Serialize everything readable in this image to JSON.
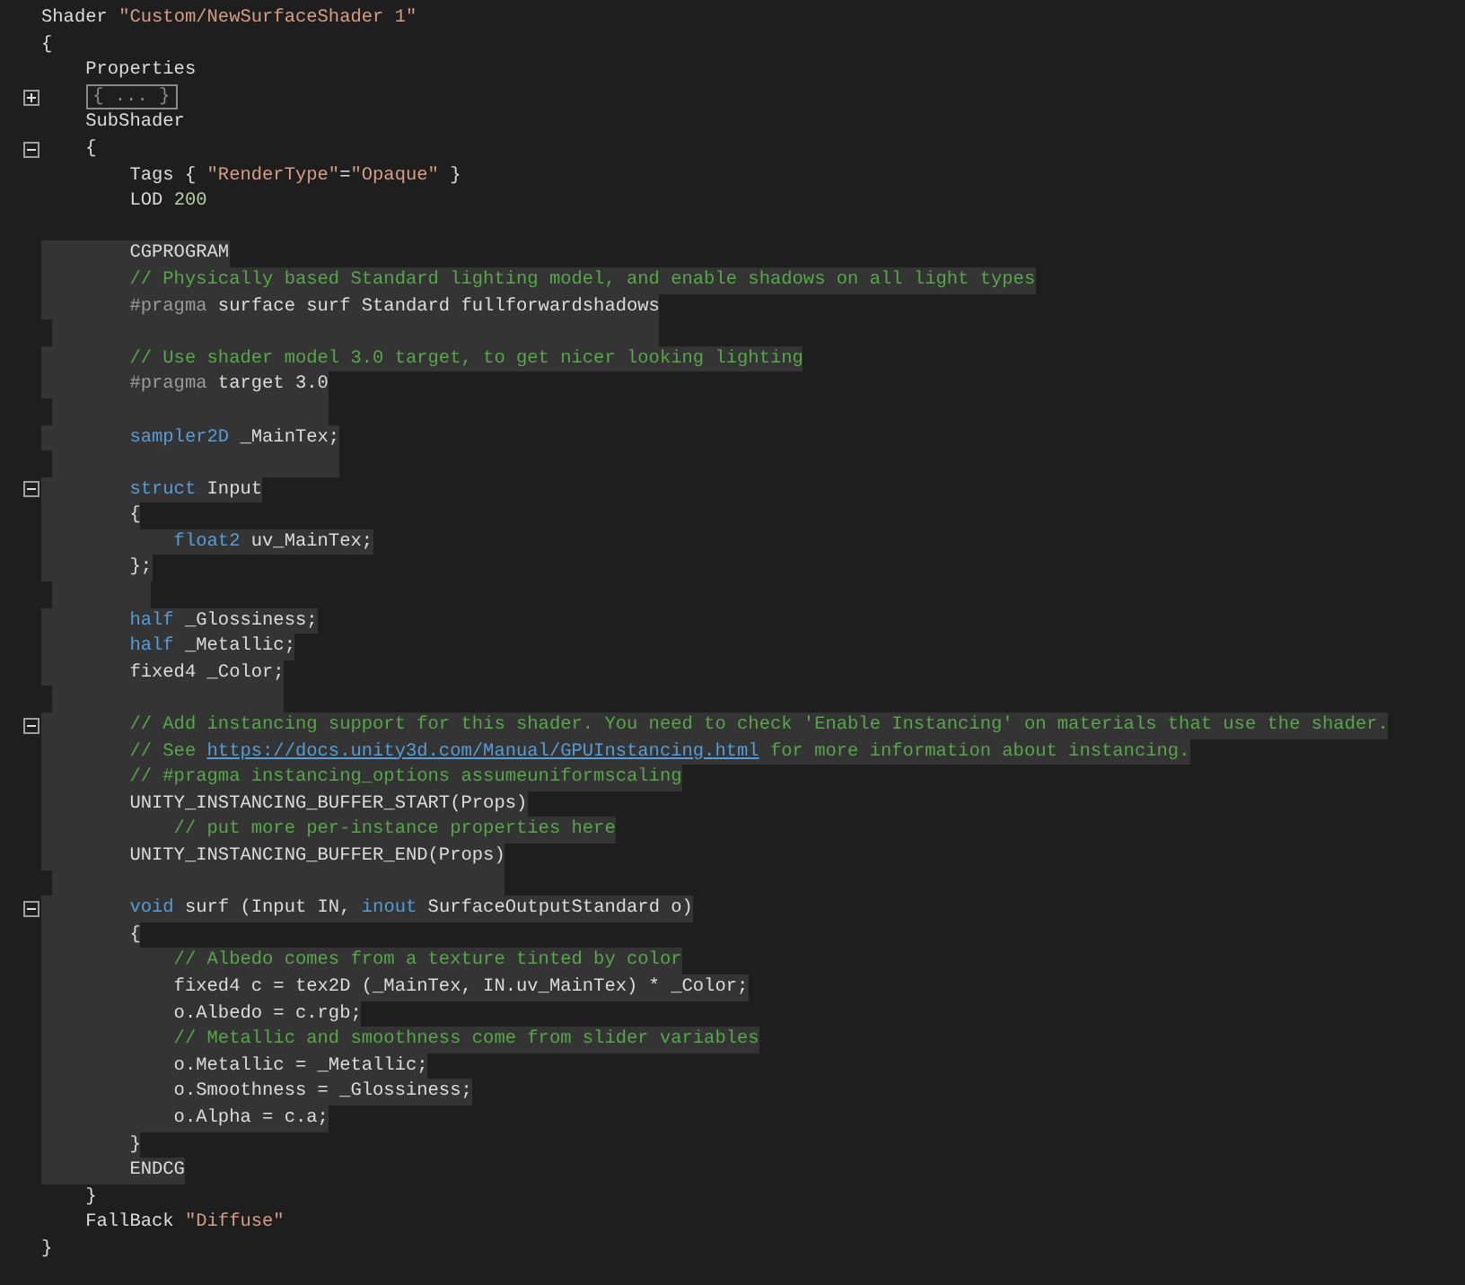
{
  "editor": {
    "lines": [
      {
        "selected": false,
        "tokens": [
          {
            "kind": "plain",
            "text": "Shader "
          },
          {
            "kind": "string",
            "text": "\"Custom/NewSurfaceShader 1\""
          }
        ]
      },
      {
        "selected": false,
        "tokens": [
          {
            "kind": "plain",
            "text": "{"
          }
        ]
      },
      {
        "selected": false,
        "tokens": [
          {
            "kind": "plain",
            "text": "    Properties"
          }
        ]
      },
      {
        "selected": false,
        "fold_expanded": false,
        "tokens": [
          {
            "kind": "collapsed",
            "text": "{ ... }"
          }
        ]
      },
      {
        "selected": false,
        "tokens": [
          {
            "kind": "plain",
            "text": "    SubShader"
          }
        ]
      },
      {
        "selected": false,
        "fold_expanded": true,
        "tokens": [
          {
            "kind": "plain",
            "text": "    {"
          }
        ]
      },
      {
        "selected": false,
        "tokens": [
          {
            "kind": "plain",
            "text": "        Tags { "
          },
          {
            "kind": "string",
            "text": "\"RenderType\""
          },
          {
            "kind": "plain",
            "text": "="
          },
          {
            "kind": "string",
            "text": "\"Opaque\""
          },
          {
            "kind": "plain",
            "text": " }"
          }
        ]
      },
      {
        "selected": false,
        "tokens": [
          {
            "kind": "plain",
            "text": "        LOD "
          },
          {
            "kind": "number",
            "text": "200"
          }
        ]
      },
      {
        "selected": false
      },
      {
        "selected": true,
        "tokens": [
          {
            "kind": "plain",
            "text": "        CGPROGRAM"
          }
        ]
      },
      {
        "selected": true,
        "tokens": [
          {
            "kind": "comment",
            "text": "        // Physically based Standard lighting model, and enable shadows on all light types"
          }
        ]
      },
      {
        "selected": true,
        "tokens": [
          {
            "kind": "directive",
            "text": "        #pragma"
          },
          {
            "kind": "plain",
            "text": " surface surf Standard fullforwardshadows"
          }
        ]
      },
      {
        "selected": true
      },
      {
        "selected": true,
        "tokens": [
          {
            "kind": "comment",
            "text": "        // Use shader model 3.0 target, to get nicer looking lighting"
          }
        ]
      },
      {
        "selected": true,
        "tokens": [
          {
            "kind": "directive",
            "text": "        #pragma"
          },
          {
            "kind": "plain",
            "text": " target 3.0"
          }
        ]
      },
      {
        "selected": true
      },
      {
        "selected": true,
        "tokens": [
          {
            "kind": "keyword",
            "text": "        sampler2D"
          },
          {
            "kind": "plain",
            "text": " _MainTex;"
          }
        ]
      },
      {
        "selected": true
      },
      {
        "selected": true,
        "fold_expanded": true,
        "tokens": [
          {
            "kind": "keyword",
            "text": "        struct"
          },
          {
            "kind": "plain",
            "text": " Input"
          }
        ]
      },
      {
        "selected": true,
        "tokens": [
          {
            "kind": "plain",
            "text": "        {"
          }
        ]
      },
      {
        "selected": true,
        "tokens": [
          {
            "kind": "keyword",
            "text": "            float2"
          },
          {
            "kind": "plain",
            "text": " uv_MainTex;"
          }
        ]
      },
      {
        "selected": true,
        "tokens": [
          {
            "kind": "plain",
            "text": "        };"
          }
        ]
      },
      {
        "selected": true
      },
      {
        "selected": true,
        "tokens": [
          {
            "kind": "keyword",
            "text": "        half"
          },
          {
            "kind": "plain",
            "text": " _Glossiness;"
          }
        ]
      },
      {
        "selected": true,
        "tokens": [
          {
            "kind": "keyword",
            "text": "        half"
          },
          {
            "kind": "plain",
            "text": " _Metallic;"
          }
        ]
      },
      {
        "selected": true,
        "tokens": [
          {
            "kind": "plain",
            "text": "        fixed4 _Color;"
          }
        ]
      },
      {
        "selected": true
      },
      {
        "selected": true,
        "fold_expanded": true,
        "tokens": [
          {
            "kind": "comment",
            "text": "        // Add instancing support for this shader. You need to check 'Enable Instancing' on materials that use the shader."
          }
        ]
      },
      {
        "selected": true,
        "tokens": [
          {
            "kind": "comment",
            "text": "        // See "
          },
          {
            "kind": "link",
            "text": "https://docs.unity3d.com/Manual/GPUInstancing.html"
          },
          {
            "kind": "comment",
            "text": " for more information about instancing."
          }
        ]
      },
      {
        "selected": true,
        "tokens": [
          {
            "kind": "comment",
            "text": "        // #pragma instancing_options assumeuniformscaling"
          }
        ]
      },
      {
        "selected": true,
        "tokens": [
          {
            "kind": "plain",
            "text": "        UNITY_INSTANCING_BUFFER_START(Props)"
          }
        ]
      },
      {
        "selected": true,
        "tokens": [
          {
            "kind": "comment",
            "text": "            // put more per-instance properties here"
          }
        ]
      },
      {
        "selected": true,
        "tokens": [
          {
            "kind": "plain",
            "text": "        UNITY_INSTANCING_BUFFER_END(Props)"
          }
        ]
      },
      {
        "selected": true
      },
      {
        "selected": true,
        "fold_expanded": true,
        "tokens": [
          {
            "kind": "keyword",
            "text": "        void"
          },
          {
            "kind": "plain",
            "text": " surf (Input IN, "
          },
          {
            "kind": "keyword",
            "text": "inout"
          },
          {
            "kind": "plain",
            "text": " SurfaceOutputStandard o)"
          }
        ]
      },
      {
        "selected": true,
        "tokens": [
          {
            "kind": "plain",
            "text": "        {"
          }
        ]
      },
      {
        "selected": true,
        "tokens": [
          {
            "kind": "comment",
            "text": "            // Albedo comes from a texture tinted by color"
          }
        ]
      },
      {
        "selected": true,
        "tokens": [
          {
            "kind": "plain",
            "text": "            fixed4 c = tex2D (_MainTex, IN.uv_MainTex) * _Color;"
          }
        ]
      },
      {
        "selected": true,
        "tokens": [
          {
            "kind": "plain",
            "text": "            o.Albedo = c.rgb;"
          }
        ]
      },
      {
        "selected": true,
        "tokens": [
          {
            "kind": "comment",
            "text": "            // Metallic and smoothness come from slider variables"
          }
        ]
      },
      {
        "selected": true,
        "tokens": [
          {
            "kind": "plain",
            "text": "            o.Metallic = _Metallic;"
          }
        ]
      },
      {
        "selected": true,
        "tokens": [
          {
            "kind": "plain",
            "text": "            o.Smoothness = _Glossiness;"
          }
        ]
      },
      {
        "selected": true,
        "tokens": [
          {
            "kind": "plain",
            "text": "            o.Alpha = c.a;"
          }
        ]
      },
      {
        "selected": true,
        "tokens": [
          {
            "kind": "plain",
            "text": "        }"
          }
        ]
      },
      {
        "selected": true,
        "tokens": [
          {
            "kind": "plain",
            "text": "        ENDCG"
          }
        ]
      },
      {
        "selected": false,
        "tokens": [
          {
            "kind": "plain",
            "text": "    }"
          }
        ]
      },
      {
        "selected": false,
        "tokens": [
          {
            "kind": "plain",
            "text": "    FallBack "
          },
          {
            "kind": "string",
            "text": "\"Diffuse\""
          }
        ]
      },
      {
        "selected": false,
        "tokens": [
          {
            "kind": "plain",
            "text": "}"
          }
        ]
      }
    ]
  }
}
